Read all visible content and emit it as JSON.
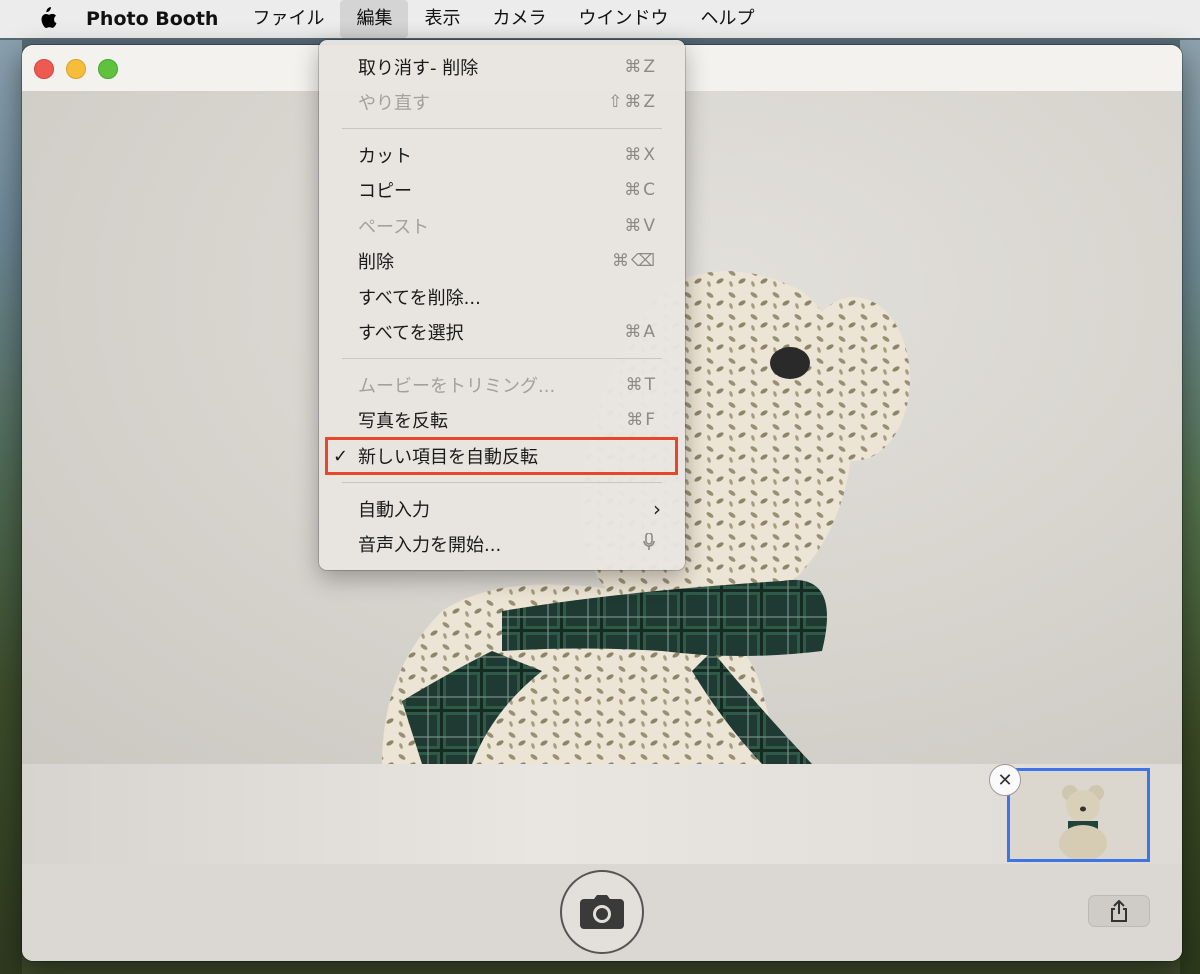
{
  "menubar": {
    "app_name": "Photo Booth",
    "items": [
      "ファイル",
      "編集",
      "表示",
      "カメラ",
      "ウインドウ",
      "ヘルプ"
    ],
    "active": "編集"
  },
  "edit_menu": {
    "items": [
      {
        "label": "取り消す- 削除",
        "shortcut": "⌘Z",
        "enabled": true
      },
      {
        "label": "やり直す",
        "shortcut": "⇧⌘Z",
        "enabled": false
      },
      {
        "label": "カット",
        "shortcut": "⌘X",
        "enabled": true
      },
      {
        "label": "コピー",
        "shortcut": "⌘C",
        "enabled": true
      },
      {
        "label": "ペースト",
        "shortcut": "⌘V",
        "enabled": false
      },
      {
        "label": "削除",
        "shortcut": "⌘⌫",
        "enabled": true
      },
      {
        "label": "すべてを削除...",
        "shortcut": "",
        "enabled": true
      },
      {
        "label": "すべてを選択",
        "shortcut": "⌘A",
        "enabled": true
      },
      {
        "label": "ムービーをトリミング...",
        "shortcut": "⌘T",
        "enabled": false
      },
      {
        "label": "写真を反転",
        "shortcut": "⌘F",
        "enabled": true
      },
      {
        "label": "新しい項目を自動反転",
        "shortcut": "",
        "enabled": true,
        "checked": true,
        "highlighted": true
      },
      {
        "label": "自動入力",
        "shortcut": "",
        "enabled": true,
        "submenu": true
      },
      {
        "label": "音声入力を開始...",
        "shortcut": "mic-icon",
        "enabled": true
      }
    ],
    "checkmark": "✓",
    "submenu_arrow": "›"
  },
  "thumbnail": {
    "close_symbol": "✕"
  },
  "colors": {
    "highlight_border": "#e6472a",
    "thumbnail_border": "#3d74e6"
  }
}
